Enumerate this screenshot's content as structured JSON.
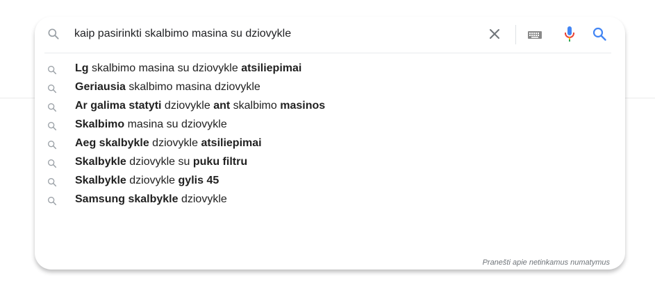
{
  "search": {
    "query": "kaip pasirinkti skalbimo masina su dziovykle",
    "icons": {
      "leading": "search-icon",
      "clear": "close-icon",
      "keyboard": "keyboard-icon",
      "voice": "microphone-icon",
      "submit": "search-icon"
    }
  },
  "suggestions": [
    [
      {
        "t": "Lg",
        "b": true
      },
      {
        "t": " skalbimo masina su dziovykle ",
        "b": false
      },
      {
        "t": "atsiliepimai",
        "b": true
      }
    ],
    [
      {
        "t": "Geriausia",
        "b": true
      },
      {
        "t": " skalbimo masina dziovykle",
        "b": false
      }
    ],
    [
      {
        "t": "Ar galima statyti",
        "b": true
      },
      {
        "t": " dziovykle ",
        "b": false
      },
      {
        "t": "ant",
        "b": true
      },
      {
        "t": " skalbimo ",
        "b": false
      },
      {
        "t": "masinos",
        "b": true
      }
    ],
    [
      {
        "t": "Skalbimo",
        "b": true
      },
      {
        "t": " masina su dziovykle",
        "b": false
      }
    ],
    [
      {
        "t": "Aeg skalbykle",
        "b": true
      },
      {
        "t": " dziovykle ",
        "b": false
      },
      {
        "t": "atsiliepimai",
        "b": true
      }
    ],
    [
      {
        "t": "Skalbykle",
        "b": true
      },
      {
        "t": " dziovykle su ",
        "b": false
      },
      {
        "t": "puku filtru",
        "b": true
      }
    ],
    [
      {
        "t": "Skalbykle",
        "b": true
      },
      {
        "t": " dziovykle ",
        "b": false
      },
      {
        "t": "gylis 45",
        "b": true
      }
    ],
    [
      {
        "t": "Samsung skalbykle",
        "b": true
      },
      {
        "t": " dziovykle",
        "b": false
      }
    ]
  ],
  "footer": {
    "report_label": "Pranešti apie netinkamus numatymus"
  },
  "colors": {
    "mic_blue": "#4285f4",
    "mic_red": "#ea4335",
    "mic_yellow": "#fbbc05",
    "mic_green": "#34a853",
    "search_blue": "#4285f4",
    "icon_gray": "#9aa0a6"
  }
}
